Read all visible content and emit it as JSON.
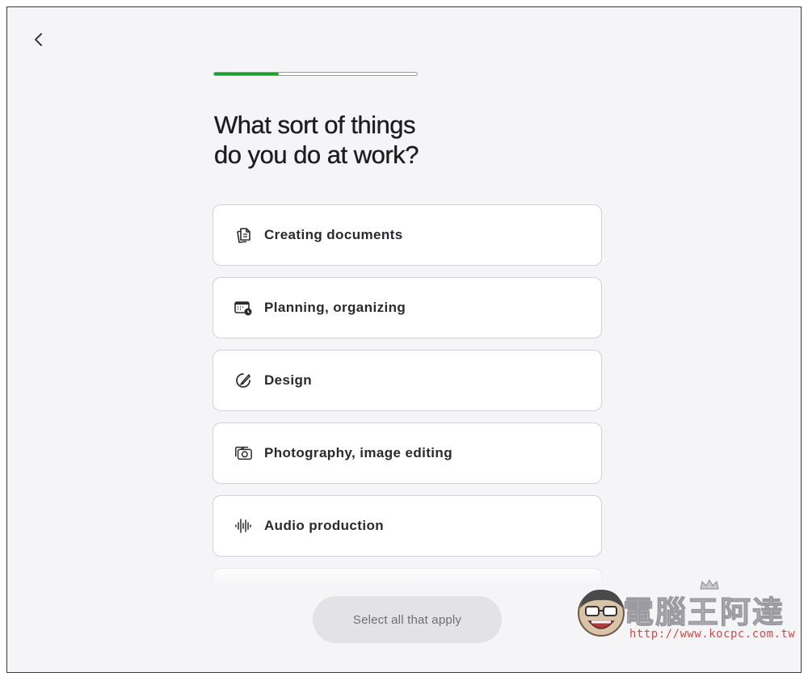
{
  "header": {
    "back_icon": "chevron-left-icon",
    "progress_fraction": 0.32
  },
  "question": {
    "line1": "What sort of things",
    "line2": "do you do at work?"
  },
  "options": [
    {
      "label": "Creating documents",
      "icon": "documents-icon"
    },
    {
      "label": "Planning, organizing",
      "icon": "calendar-icon"
    },
    {
      "label": "Design",
      "icon": "design-icon"
    },
    {
      "label": "Photography, image editing",
      "icon": "photos-icon"
    },
    {
      "label": "Audio production",
      "icon": "waveform-icon"
    }
  ],
  "footer": {
    "button_label": "Select all that apply"
  },
  "watermark": {
    "title": "電腦王阿達",
    "url": "http://www.kocpc.com.tw"
  },
  "colors": {
    "progress": "#1f9d2c",
    "background": "#f5f5f7"
  }
}
